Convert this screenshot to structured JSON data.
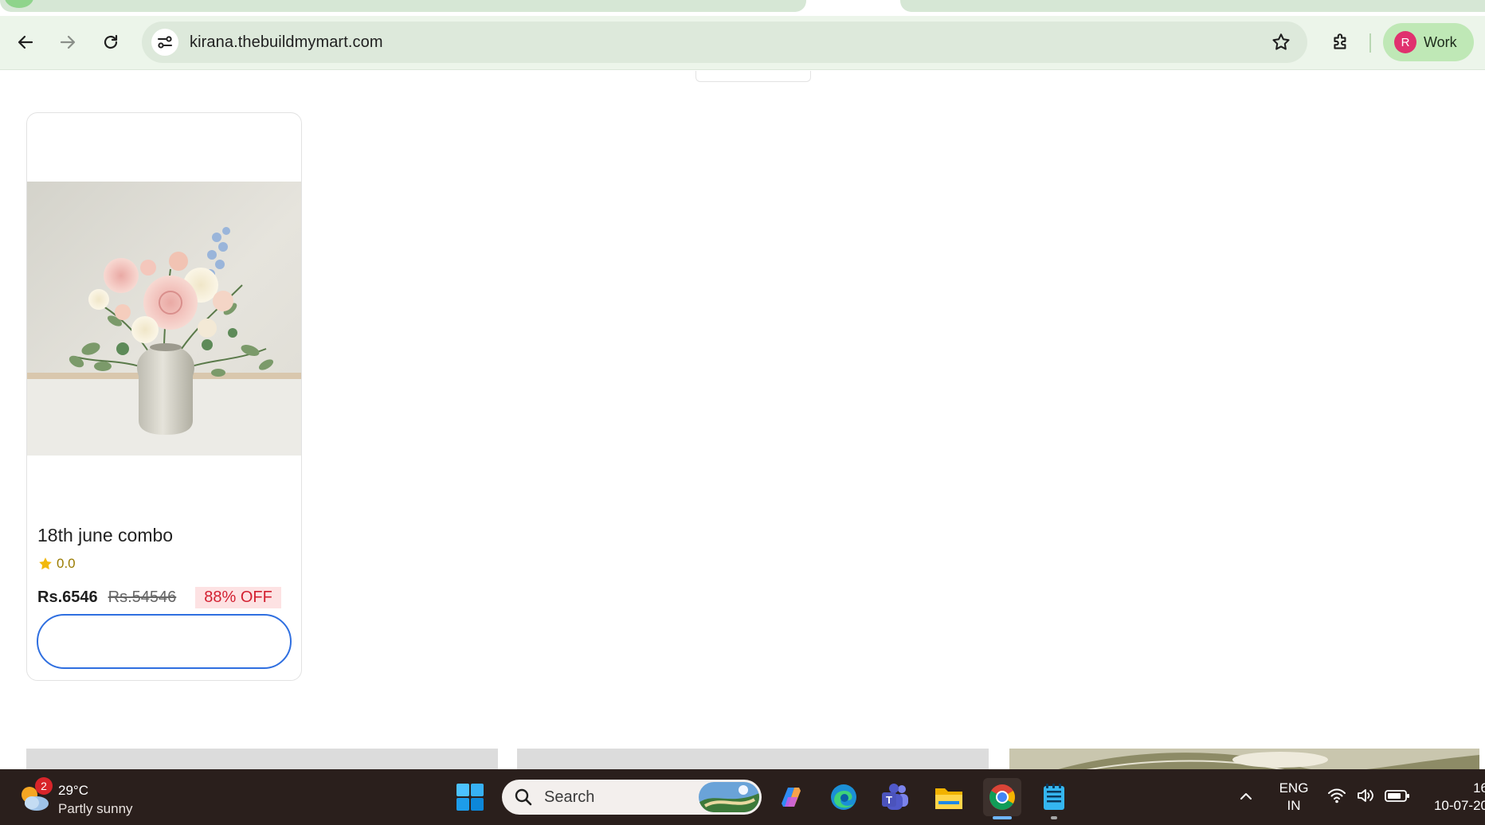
{
  "browser": {
    "url": "kirana.thebuildmymart.com",
    "profile_initial": "R",
    "profile_label": "Work"
  },
  "product": {
    "title": "18th june combo",
    "rating": "0.0",
    "price": "Rs.6546",
    "mrp": "Rs.54546",
    "discount": "88% OFF",
    "button_label": ""
  },
  "taskbar": {
    "weather_badge": "2",
    "weather_temp": "29°C",
    "weather_desc": "Partly sunny",
    "search_label": "Search",
    "lang_line1": "ENG",
    "lang_line2": "IN",
    "clock_time": "16",
    "clock_date": "10-07-20"
  },
  "colors": {
    "accent_blue": "#2f6fe0",
    "discount_red": "#d32031",
    "discount_bg": "#fde2e3",
    "rating_gold": "#f2b90c",
    "chrome_green": "#ecf5ea",
    "taskbar": "#2a1f1c"
  },
  "icons": {
    "toolbar": [
      "back-icon",
      "forward-icon",
      "reload-icon",
      "site-info-icon",
      "bookmark-star-icon",
      "extensions-icon"
    ],
    "taskbar": [
      "windows-start-icon",
      "search-icon",
      "copilot-icon",
      "edge-icon",
      "teams-icon",
      "file-explorer-icon",
      "chrome-icon",
      "notepad-icon",
      "chevron-up-icon",
      "wifi-icon",
      "volume-icon",
      "battery-icon"
    ]
  }
}
